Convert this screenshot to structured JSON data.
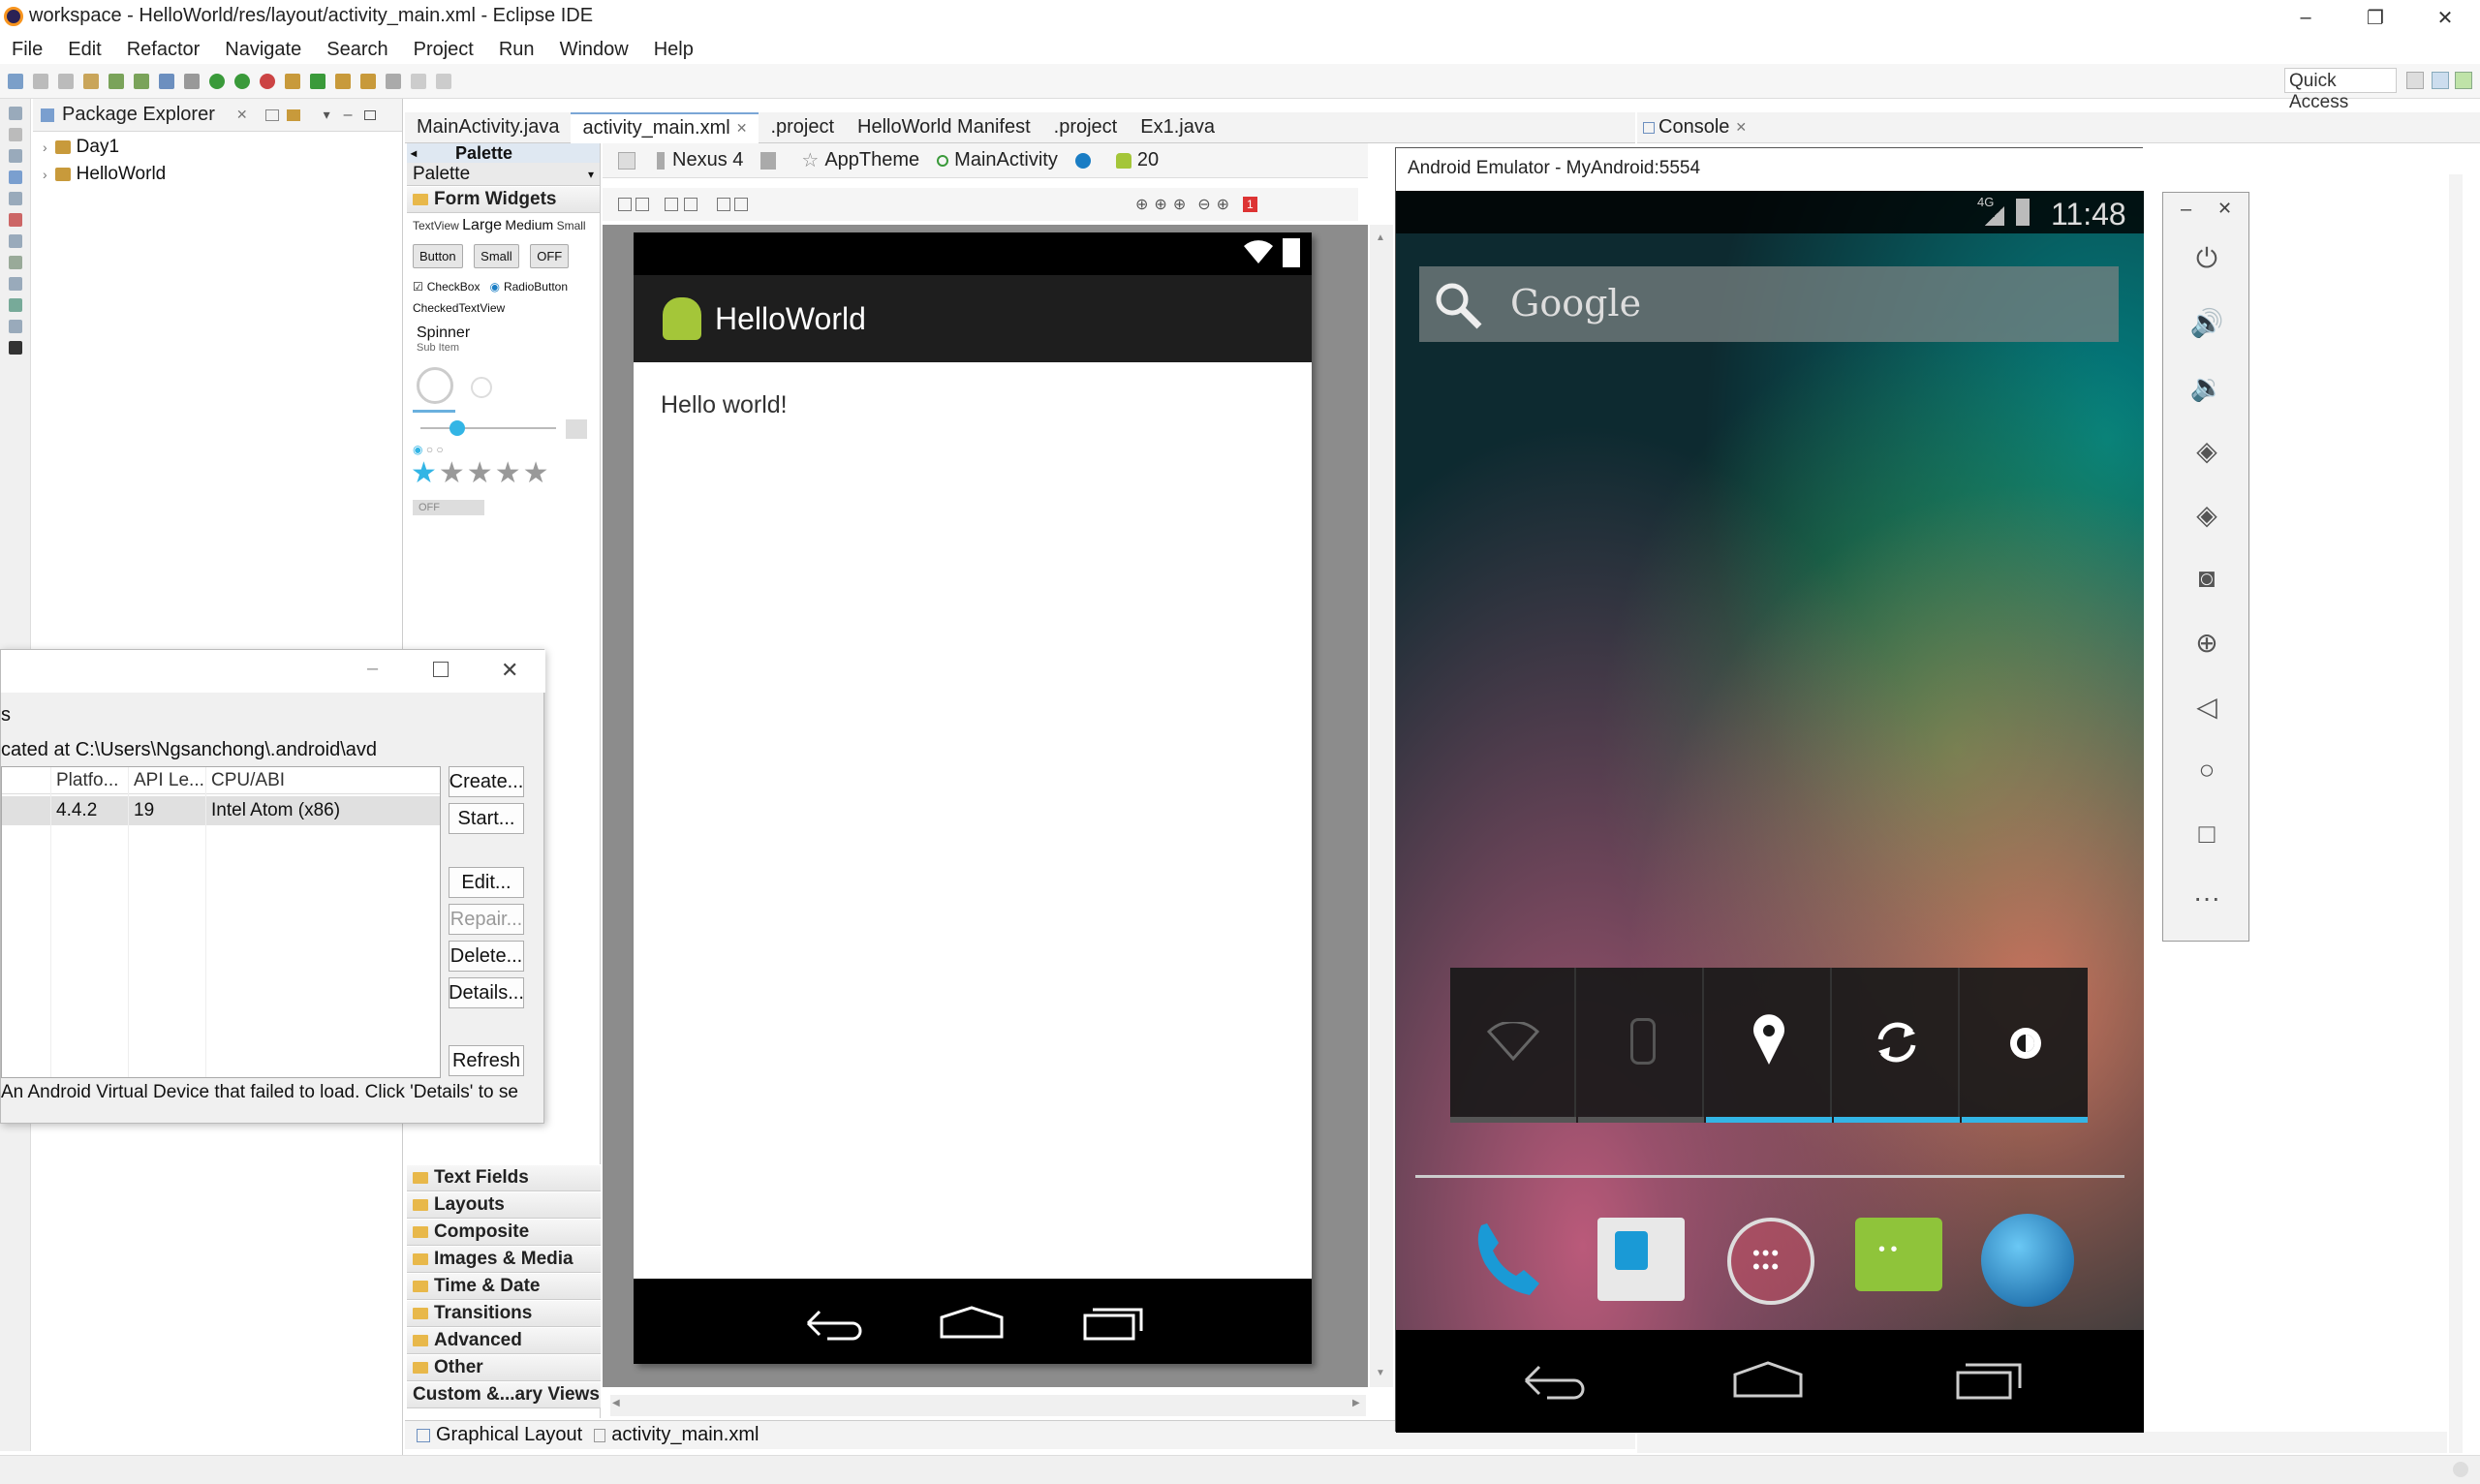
{
  "window": {
    "title": "workspace - HelloWorld/res/layout/activity_main.xml - Eclipse IDE",
    "controls": [
      "–",
      "❐",
      "✕"
    ]
  },
  "menu": [
    "File",
    "Edit",
    "Refactor",
    "Navigate",
    "Search",
    "Project",
    "Run",
    "Window",
    "Help"
  ],
  "toolbar": {
    "quick_access": "Quick Access"
  },
  "package_explorer": {
    "title": "Package Explorer",
    "items": [
      {
        "label": "Day1"
      },
      {
        "label": "HelloWorld"
      }
    ]
  },
  "editor_tabs": [
    {
      "label": "MainActivity.java",
      "active": false
    },
    {
      "label": "activity_main.xml",
      "active": true
    },
    {
      "label": ".project",
      "active": false
    },
    {
      "label": "HelloWorld Manifest",
      "active": false
    },
    {
      "label": ".project",
      "active": false
    },
    {
      "label": "Ex1.java",
      "active": false
    }
  ],
  "console": {
    "title": "Console"
  },
  "palette": {
    "header_top": "Palette",
    "header": "Palette",
    "form_widgets": "Form Widgets",
    "textview_row": [
      "TextView",
      "Large",
      "Medium",
      "Small"
    ],
    "buttons": [
      "Button",
      "Small",
      "OFF"
    ],
    "checkbox": "CheckBox",
    "radiobutton": "RadioButton",
    "checkedtextview": "CheckedTextView",
    "spinner": "Spinner",
    "spinner_sub": "Sub Item",
    "toggle_off": "OFF",
    "categories": [
      "Text Fields",
      "Layouts",
      "Composite",
      "Images & Media",
      "Time & Date",
      "Transitions",
      "Advanced",
      "Other",
      "Custom &...ary Views"
    ]
  },
  "layout_toolbar": {
    "device": "Nexus 4",
    "theme": "AppTheme",
    "activity": "MainActivity",
    "api": "20",
    "error_count": "1"
  },
  "preview": {
    "app_title": "HelloWorld",
    "content_text": "Hello world!"
  },
  "bottom_tabs": [
    "Graphical Layout",
    "activity_main.xml"
  ],
  "avd_dialog": {
    "tab_fragment": "s",
    "location": "cated at C:\\Users\\Ngsanchong\\.android\\avd",
    "columns": [
      "Platfo...",
      "API Le...",
      "CPU/ABI"
    ],
    "rows": [
      {
        "platform": "4.4.2",
        "api": "19",
        "cpu": "Intel Atom (x86)"
      }
    ],
    "buttons": [
      "Create...",
      "Start...",
      "Edit...",
      "Repair...",
      "Delete...",
      "Details...",
      "Refresh"
    ],
    "footer": "An Android Virtual Device that failed to load. Click 'Details' to se"
  },
  "emulator": {
    "title": "Android Emulator - MyAndroid:5554",
    "network": "4G",
    "time": "11:48",
    "search_placeholder": "Google",
    "quick_settings": [
      "wifi-icon",
      "bluetooth-icon",
      "location-icon",
      "sync-icon",
      "brightness-icon"
    ],
    "dock": [
      "phone-icon",
      "contacts-icon",
      "apps-icon",
      "messaging-icon",
      "browser-icon"
    ],
    "side_controls": [
      "power-icon",
      "volume-up-icon",
      "volume-down-icon",
      "rotate-left-icon",
      "rotate-right-icon",
      "camera-icon",
      "zoom-icon",
      "back-icon",
      "home-icon",
      "overview-icon",
      "more-icon"
    ],
    "side_window": [
      "–",
      "✕"
    ]
  },
  "colors": {
    "accent_blue": "#33b5e5",
    "eclipse_tab_border": "#7aa6d6",
    "android_green": "#a4c639"
  }
}
